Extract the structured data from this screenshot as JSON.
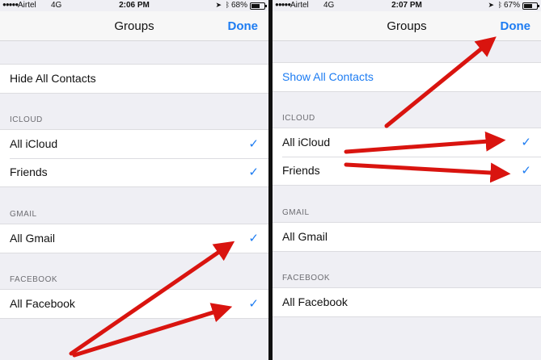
{
  "left": {
    "status": {
      "signal": "●●●●●",
      "carrier": "Airtel",
      "network": "4G",
      "time": "2:06 PM",
      "battery": "68%",
      "battery_level": 0.68
    },
    "nav": {
      "title": "Groups",
      "done": "Done"
    },
    "toggle_all": "Hide All Contacts",
    "sections": [
      {
        "header": "ICLOUD",
        "items": [
          {
            "label": "All iCloud",
            "check": "✓"
          },
          {
            "label": "Friends",
            "check": "✓"
          }
        ]
      },
      {
        "header": "GMAIL",
        "items": [
          {
            "label": "All Gmail",
            "check": "✓"
          }
        ]
      },
      {
        "header": "FACEBOOK",
        "items": [
          {
            "label": "All Facebook",
            "check": "✓"
          }
        ]
      }
    ]
  },
  "right": {
    "status": {
      "signal": "●●●●●",
      "carrier": "Airtel",
      "network": "4G",
      "time": "2:07 PM",
      "battery": "67%",
      "battery_level": 0.67
    },
    "nav": {
      "title": "Groups",
      "done": "Done"
    },
    "toggle_all": "Show All Contacts",
    "sections": [
      {
        "header": "ICLOUD",
        "items": [
          {
            "label": "All iCloud",
            "check": "✓"
          },
          {
            "label": "Friends",
            "check": "✓"
          }
        ]
      },
      {
        "header": "GMAIL",
        "items": [
          {
            "label": "All Gmail",
            "check": ""
          }
        ]
      },
      {
        "header": "FACEBOOK",
        "items": [
          {
            "label": "All Facebook",
            "check": ""
          }
        ]
      }
    ]
  },
  "icons": {
    "location": "location-arrow-icon",
    "bluetooth": "bluetooth-icon",
    "battery": "battery-icon",
    "checkmark": "checkmark-icon"
  },
  "colors": {
    "accent": "#1d7cf2",
    "arrow": "#d9140f",
    "background": "#efeff4"
  }
}
